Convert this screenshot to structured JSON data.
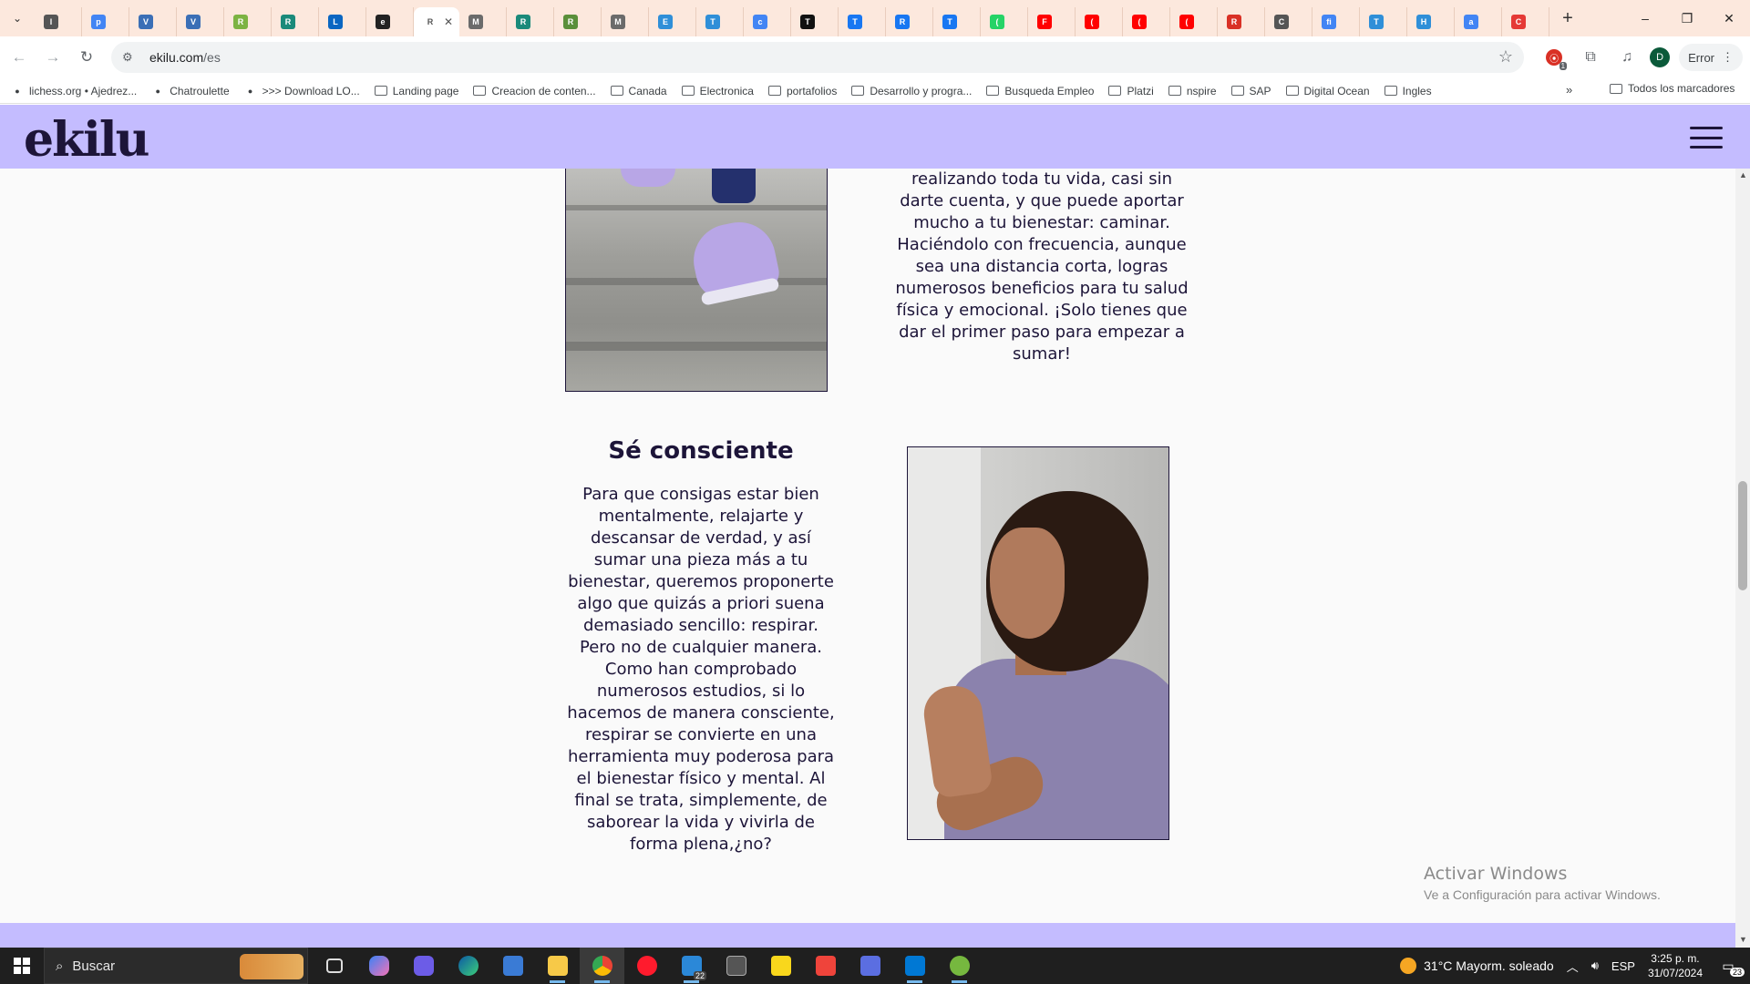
{
  "browser": {
    "tabs": [
      {
        "letter": "l",
        "color": "#555555",
        "active": false
      },
      {
        "letter": "p",
        "color": "#4285f4",
        "active": false
      },
      {
        "letter": "V",
        "color": "#3b6fb6",
        "active": false
      },
      {
        "letter": "V",
        "color": "#3b6fb6",
        "active": false
      },
      {
        "letter": "R",
        "color": "#7cb342",
        "active": false
      },
      {
        "letter": "R",
        "color": "#1a8a7a",
        "active": false
      },
      {
        "letter": "L",
        "color": "#0a66c2",
        "active": false
      },
      {
        "letter": "e",
        "color": "#222222",
        "active": false
      },
      {
        "letter": "R",
        "color": "#ffffff",
        "active": true
      },
      {
        "letter": "M",
        "color": "#6b6b6b",
        "active": false
      },
      {
        "letter": "R",
        "color": "#1a8a7a",
        "active": false
      },
      {
        "letter": "R",
        "color": "#5a8f3a",
        "active": false
      },
      {
        "letter": "M",
        "color": "#6b6b6b",
        "active": false
      },
      {
        "letter": "E",
        "color": "#2f8fd8",
        "active": false
      },
      {
        "letter": "T",
        "color": "#2f8fd8",
        "active": false
      },
      {
        "letter": "c",
        "color": "#4285f4",
        "active": false
      },
      {
        "letter": "T",
        "color": "#111111",
        "active": false
      },
      {
        "letter": "T",
        "color": "#1877f2",
        "active": false
      },
      {
        "letter": "R",
        "color": "#1877f2",
        "active": false
      },
      {
        "letter": "T",
        "color": "#1877f2",
        "active": false
      },
      {
        "letter": "(",
        "color": "#25d366",
        "active": false
      },
      {
        "letter": "F",
        "color": "#ff0000",
        "active": false
      },
      {
        "letter": "(",
        "color": "#ff0000",
        "active": false
      },
      {
        "letter": "(",
        "color": "#ff0000",
        "active": false
      },
      {
        "letter": "(",
        "color": "#ff0000",
        "active": false
      },
      {
        "letter": "R",
        "color": "#d93025",
        "active": false
      },
      {
        "letter": "C",
        "color": "#555555",
        "active": false
      },
      {
        "letter": "fi",
        "color": "#4285f4",
        "active": false
      },
      {
        "letter": "T",
        "color": "#2f8fd8",
        "active": false
      },
      {
        "letter": "H",
        "color": "#2f8fd8",
        "active": false
      },
      {
        "letter": "a",
        "color": "#4285f4",
        "active": false
      },
      {
        "letter": "C",
        "color": "#e53935",
        "active": false
      }
    ],
    "new_tab_glyph": "+",
    "window_controls": {
      "minimize": "–",
      "restore": "❐",
      "close": "✕"
    },
    "url_host": "ekilu.com",
    "url_path": "/es",
    "extension_count": "1",
    "profile_initial": "D",
    "error_label": "Error",
    "bookmarks": [
      {
        "label": "lichess.org • Ajedrez...",
        "type": "site"
      },
      {
        "label": "Chatroulette",
        "type": "site"
      },
      {
        "label": ">>> Download LO...",
        "type": "site"
      },
      {
        "label": "Landing page",
        "type": "folder"
      },
      {
        "label": "Creacion de conten...",
        "type": "folder"
      },
      {
        "label": "Canada",
        "type": "folder"
      },
      {
        "label": "Electronica",
        "type": "folder"
      },
      {
        "label": "portafolios",
        "type": "folder"
      },
      {
        "label": "Desarrollo y progra...",
        "type": "folder"
      },
      {
        "label": "Busqueda Empleo",
        "type": "folder"
      },
      {
        "label": "Platzi",
        "type": "folder"
      },
      {
        "label": "nspire",
        "type": "folder"
      },
      {
        "label": "SAP",
        "type": "folder"
      },
      {
        "label": "Digital Ocean",
        "type": "folder"
      },
      {
        "label": "Ingles",
        "type": "folder"
      }
    ],
    "bookmarks_more": "»",
    "all_bookmarks": "Todos los marcadores"
  },
  "page": {
    "logo": "ekilu",
    "section1_text": "realizando toda tu vida, casi sin darte cuenta, y que puede aportar mucho a tu bienestar: caminar. Haciéndolo con frecuencia, aunque sea una distancia corta, logras numerosos beneficios para tu salud física y emocional. ¡Solo tienes que dar el primer paso para empezar a sumar!",
    "section2_title": "Sé consciente",
    "section2_text": "Para que consigas estar bien mentalmente, relajarte y descansar de verdad, y así sumar una pieza más a tu bienestar, queremos proponerte algo que quizás a priori suena demasiado sencillo: respirar. Pero no de cualquier manera. Como han comprobado numerosos estudios, si lo hacemos de manera consciente, respirar se convierte en una herramienta muy poderosa para el bienestar físico y mental. Al final se trata, simplemente, de saborear la vida y vivirla de forma plena,¿no?",
    "brand_color": "#c4bcff",
    "text_color": "#1d1539"
  },
  "watermark": {
    "title": "Activar Windows",
    "subtitle": "Ve a Configuración para activar Windows."
  },
  "taskbar": {
    "search_placeholder": "Buscar",
    "weather": "31°C  Mayorm. soleado",
    "language": "ESP",
    "time": "3:25 p. m.",
    "date": "31/07/2024",
    "notifications": "23",
    "mail_badge": "22"
  }
}
